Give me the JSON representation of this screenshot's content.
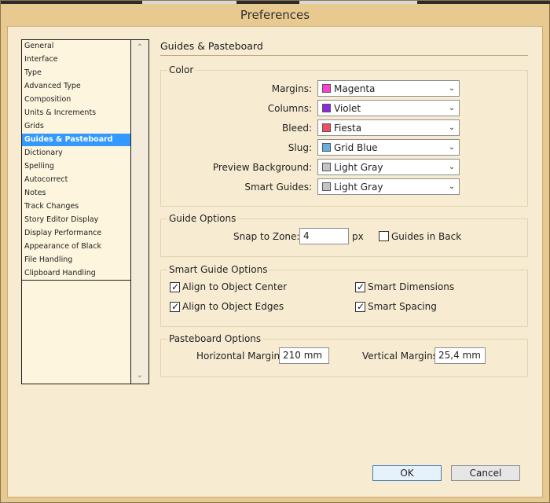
{
  "dialog": {
    "title": "Preferences"
  },
  "sidebar": {
    "items": [
      "General",
      "Interface",
      "Type",
      "Advanced Type",
      "Composition",
      "Units & Increments",
      "Grids",
      "Guides & Pasteboard",
      "Dictionary",
      "Spelling",
      "Autocorrect",
      "Notes",
      "Track Changes",
      "Story Editor Display",
      "Display Performance",
      "Appearance of Black",
      "File Handling",
      "Clipboard Handling"
    ],
    "selected_index": 7
  },
  "page": {
    "title": "Guides & Pasteboard"
  },
  "color": {
    "legend": "Color",
    "rows": [
      {
        "label": "Margins:",
        "value": "Magenta",
        "swatch": "#ff3ecf"
      },
      {
        "label": "Columns:",
        "value": "Violet",
        "swatch": "#8a2be2"
      },
      {
        "label": "Bleed:",
        "value": "Fiesta",
        "swatch": "#f2505f"
      },
      {
        "label": "Slug:",
        "value": "Grid Blue",
        "swatch": "#6aaee0"
      },
      {
        "label": "Preview Background:",
        "value": "Light Gray",
        "swatch": "#c4c4c4"
      },
      {
        "label": "Smart Guides:",
        "value": "Light Gray",
        "swatch": "#c4c4c4"
      }
    ]
  },
  "guide_options": {
    "legend": "Guide Options",
    "snap_label": "Snap to Zone:",
    "snap_value": "4",
    "snap_unit": "px",
    "guides_in_back_label": "Guides in Back",
    "guides_in_back_checked": false
  },
  "smart_guide_options": {
    "legend": "Smart Guide Options",
    "align_center_label": "Align to Object Center",
    "align_edges_label": "Align to Object Edges",
    "smart_dimensions_label": "Smart Dimensions",
    "smart_spacing_label": "Smart Spacing",
    "checked": true
  },
  "pasteboard_options": {
    "legend": "Pasteboard Options",
    "horizontal_label": "Horizontal Margins:",
    "horizontal_value": "210 mm",
    "vertical_label": "Vertical Margins:",
    "vertical_value": "25,4 mm"
  },
  "buttons": {
    "ok": "OK",
    "cancel": "Cancel"
  },
  "icons": {
    "scroll_up": "chevron-up-icon",
    "scroll_down": "chevron-down-icon",
    "dropdown": "chevron-down-icon",
    "check": "checkmark-icon"
  }
}
